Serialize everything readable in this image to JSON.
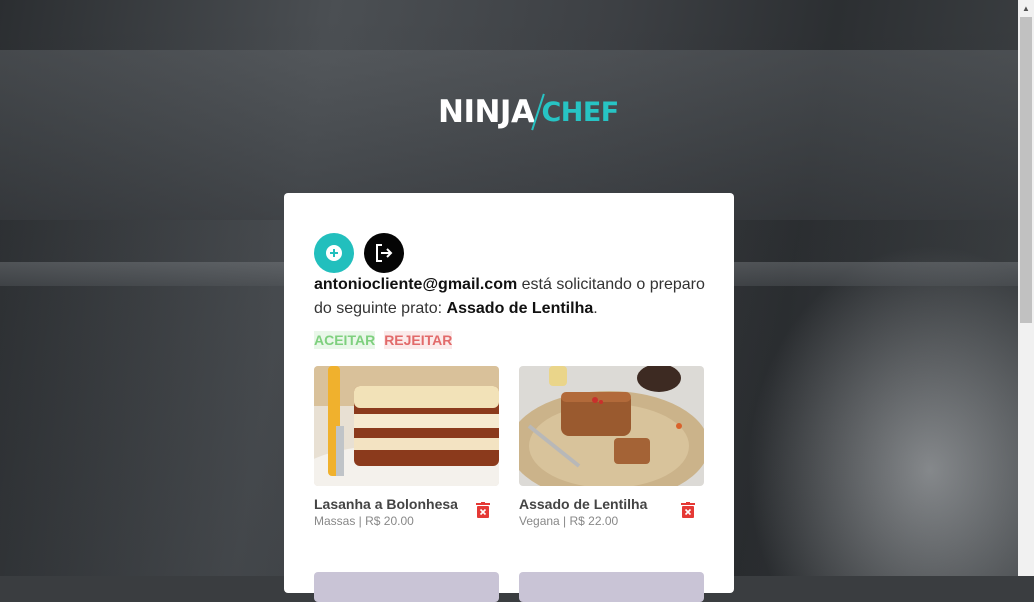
{
  "brand": {
    "name_part1": "NINJA",
    "name_part2": "CHEF"
  },
  "toolbar": {
    "add_icon": "plus-circle-icon",
    "logout_icon": "logout-icon"
  },
  "request": {
    "email": "antoniocliente@gmail.com",
    "text_middle": " está solicitando o preparo do seguinte prato: ",
    "dish": "Assado de Lentilha",
    "text_end": "."
  },
  "actions": {
    "accept_label": "ACEITAR",
    "reject_label": "REJEITAR"
  },
  "dishes": [
    {
      "name": "Lasanha a Bolonhesa",
      "meta": "Massas | R$ 20.00"
    },
    {
      "name": "Assado de Lentilha",
      "meta": "Vegana | R$ 22.00"
    }
  ],
  "colors": {
    "accent": "#22bfbd",
    "accept": "#7ed07e",
    "reject": "#e26a6a",
    "trash": "#e53935"
  }
}
